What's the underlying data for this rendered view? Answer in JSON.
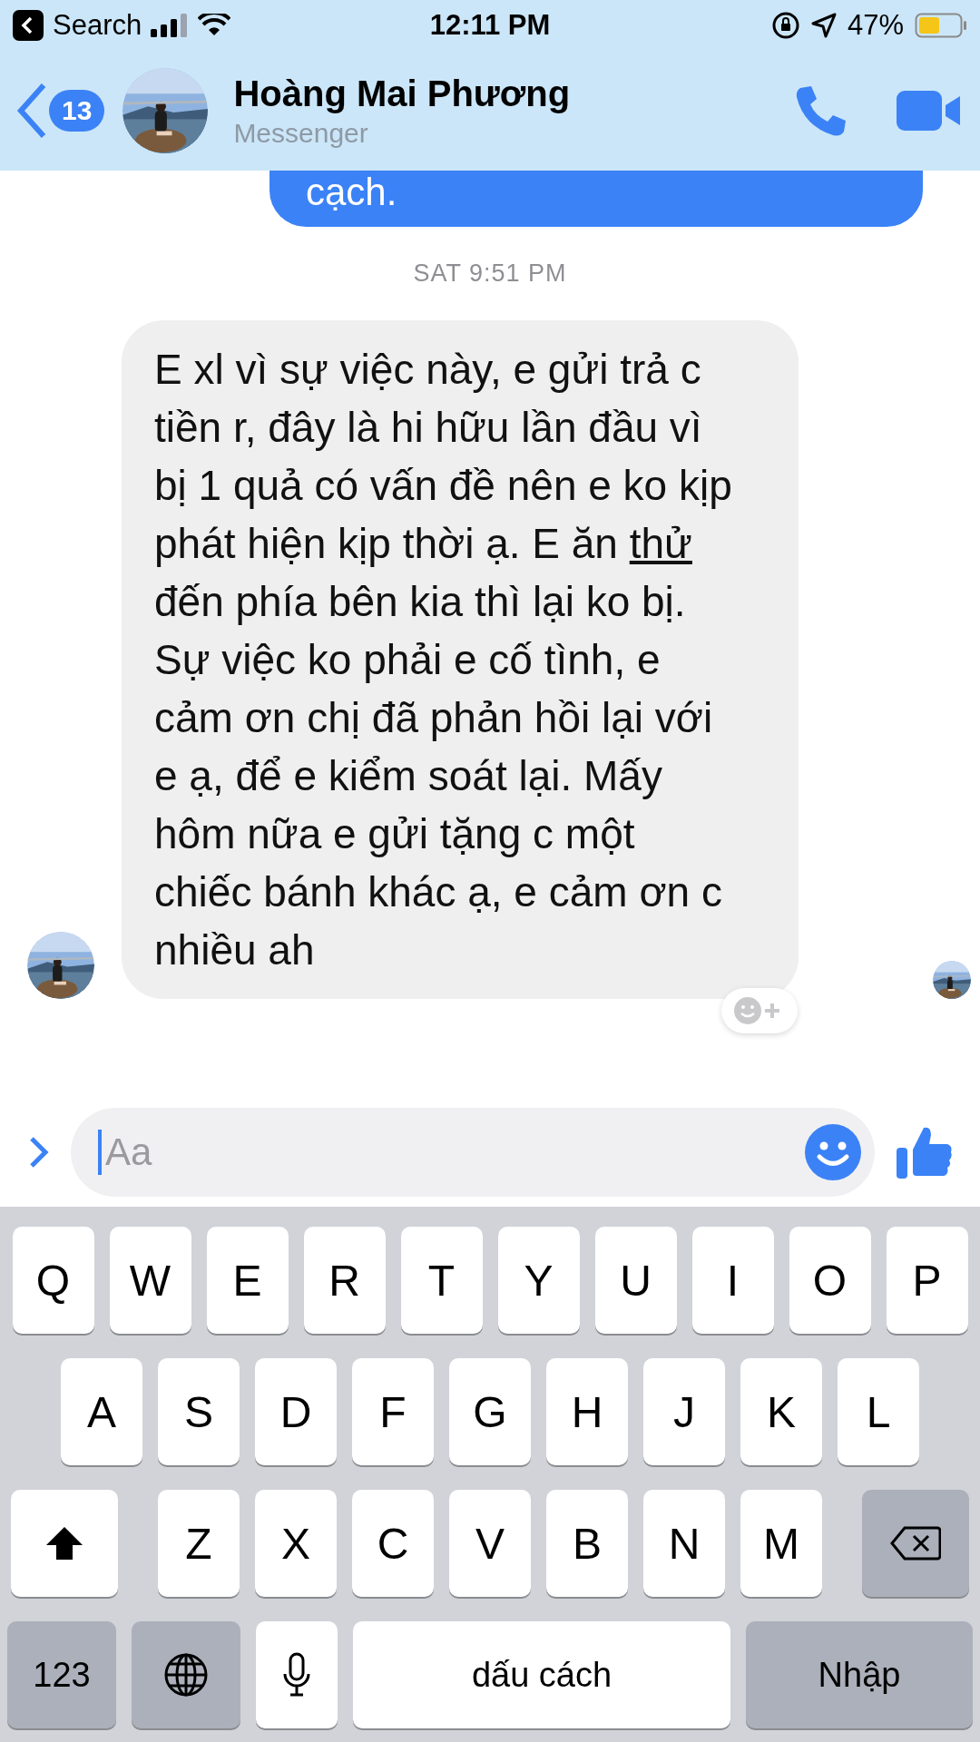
{
  "status_bar": {
    "back_label": "Search",
    "time": "12:11 PM",
    "battery": "47%"
  },
  "header": {
    "badge": "13",
    "name": "Hoàng Mai Phương",
    "subtitle": "Messenger"
  },
  "messages": [
    {
      "kind": "sent",
      "segments": [
        {
          "text": "cạch.",
          "underlined": false
        }
      ]
    },
    {
      "kind": "timestamp",
      "segments": [
        {
          "text": "SAT 9:51 PM",
          "underlined": false
        }
      ]
    },
    {
      "kind": "received",
      "segments": [
        {
          "text": "E xl vì sự việc này, e gửi trả c tiền r, đây là hi hữu lần đầu vì bị 1 quả có vấn đề nên e ko kịp phát hiện kịp thời ạ. E ăn ",
          "underlined": false
        },
        {
          "text": "thử",
          "underlined": true
        },
        {
          "text": " đến phía bên kia thì lại ko bị. Sự việc ko phải e cố tình, e cảm ơn chị đã phản hồi lại với e ạ, để e kiểm soát lại. Mấy hôm nữa e gửi tặng c một chiếc bánh khác ạ, e cảm ơn c nhiều ah",
          "underlined": false
        }
      ]
    }
  ],
  "composer": {
    "placeholder": "Aa"
  },
  "keyboard": [
    [
      {
        "kind": "letter",
        "label": "Q"
      },
      {
        "kind": "letter",
        "label": "W"
      },
      {
        "kind": "letter",
        "label": "E"
      },
      {
        "kind": "letter",
        "label": "R"
      },
      {
        "kind": "letter",
        "label": "T"
      },
      {
        "kind": "letter",
        "label": "Y"
      },
      {
        "kind": "letter",
        "label": "U"
      },
      {
        "kind": "letter",
        "label": "I"
      },
      {
        "kind": "letter",
        "label": "O"
      },
      {
        "kind": "letter",
        "label": "P"
      }
    ],
    [
      {
        "kind": "letter",
        "label": "A"
      },
      {
        "kind": "letter",
        "label": "S"
      },
      {
        "kind": "letter",
        "label": "D"
      },
      {
        "kind": "letter",
        "label": "F"
      },
      {
        "kind": "letter",
        "label": "G"
      },
      {
        "kind": "letter",
        "label": "H"
      },
      {
        "kind": "letter",
        "label": "J"
      },
      {
        "kind": "letter",
        "label": "K"
      },
      {
        "kind": "letter",
        "label": "L"
      }
    ],
    [
      {
        "kind": "shift"
      },
      {
        "kind": "letter",
        "label": "Z"
      },
      {
        "kind": "letter",
        "label": "X"
      },
      {
        "kind": "letter",
        "label": "C"
      },
      {
        "kind": "letter",
        "label": "V"
      },
      {
        "kind": "letter",
        "label": "B"
      },
      {
        "kind": "letter",
        "label": "N"
      },
      {
        "kind": "letter",
        "label": "M"
      },
      {
        "kind": "backspace"
      }
    ],
    [
      {
        "kind": "numbers",
        "label": "123"
      },
      {
        "kind": "globe"
      },
      {
        "kind": "mic"
      },
      {
        "kind": "space",
        "label": "dấu cách"
      },
      {
        "kind": "return",
        "label": "Nhập"
      }
    ]
  ]
}
